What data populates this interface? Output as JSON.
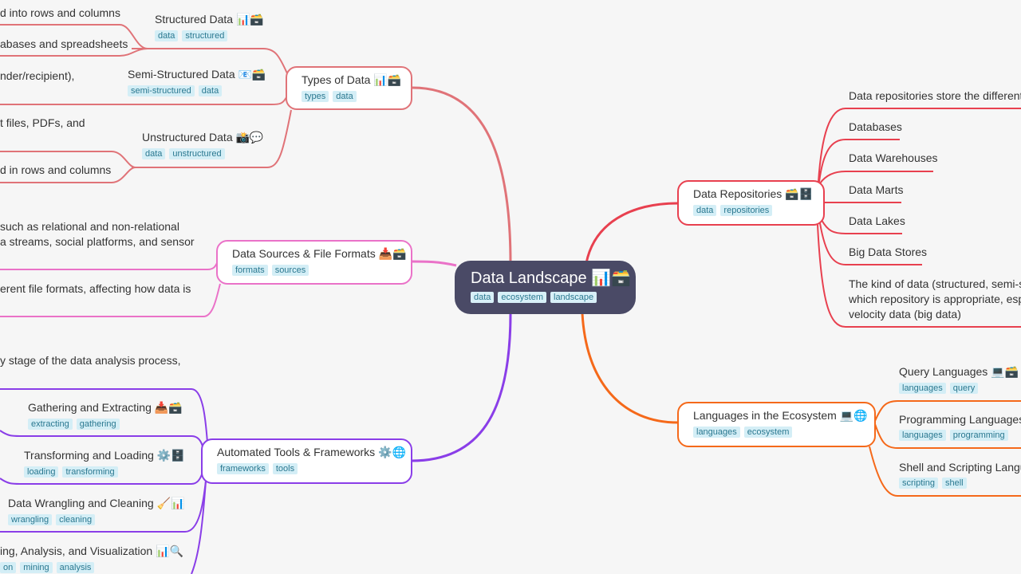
{
  "colors": {
    "types": "#e07378",
    "repositories": "#e8404f",
    "sources": "#ea72c8",
    "tools": "#8a3ee8",
    "languages": "#f5691a",
    "center": "#4a4a66",
    "tag_bg": "#d4eef6"
  },
  "center": {
    "title": "Data Landscape 📊🗃️",
    "tags": [
      "data",
      "ecosystem",
      "landscape"
    ]
  },
  "types": {
    "title": "Types of Data 📊🗃️",
    "tags": [
      "types",
      "data"
    ],
    "children": [
      {
        "title": "Structured Data 📊🗃️",
        "tags": [
          "data",
          "structured"
        ],
        "details": [
          "d into rows and columns",
          "abases and spreadsheets"
        ]
      },
      {
        "title": "Semi-Structured Data 📧🗃️",
        "tags": [
          "semi-structured",
          "data"
        ],
        "details": [
          "nder/recipient),"
        ]
      },
      {
        "title": "Unstructured Data 📸💬",
        "tags": [
          "data",
          "unstructured"
        ],
        "details": [
          "t files, PDFs, and",
          "d in rows and columns"
        ]
      }
    ]
  },
  "sources": {
    "title": "Data Sources & File Formats 📥🗃️",
    "tags": [
      "formats",
      "sources"
    ],
    "details": [
      "such as relational and non-relational",
      "a streams, social platforms, and sensor",
      "erent file formats, affecting how data is"
    ]
  },
  "tools": {
    "title": "Automated Tools & Frameworks ⚙️🌐",
    "tags": [
      "frameworks",
      "tools"
    ],
    "detail": "y stage of the data analysis process,",
    "children": [
      {
        "title": "Gathering and Extracting 📥🗃️",
        "tags": [
          "extracting",
          "gathering"
        ]
      },
      {
        "title": "Transforming and Loading ⚙️🗄️",
        "tags": [
          "loading",
          "transforming"
        ]
      },
      {
        "title": "Data Wrangling and Cleaning 🧹📊",
        "tags": [
          "wrangling",
          "cleaning"
        ]
      },
      {
        "title": "ing, Analysis, and Visualization 📊🔍",
        "tags": [
          "on",
          "mining",
          "analysis"
        ]
      }
    ]
  },
  "repositories": {
    "title": "Data Repositories 🗃️🗄️",
    "tags": [
      "data",
      "repositories"
    ],
    "children": [
      "Data repositories store the different t",
      "Databases",
      "Data Warehouses",
      "Data Marts",
      "Data Lakes",
      "Big Data Stores"
    ],
    "note": [
      "The kind of data (structured, semi-st",
      "which repository is appropriate, esp",
      "velocity data (big data)"
    ]
  },
  "languages": {
    "title": "Languages in the Ecosystem 💻🌐",
    "tags": [
      "languages",
      "ecosystem"
    ],
    "children": [
      {
        "title": "Query Languages 💻🗃️",
        "tags": [
          "languages",
          "query"
        ]
      },
      {
        "title": "Programming Languages",
        "tags": [
          "languages",
          "programming"
        ]
      },
      {
        "title": "Shell and Scripting Langu",
        "tags": [
          "scripting",
          "shell"
        ]
      }
    ]
  }
}
